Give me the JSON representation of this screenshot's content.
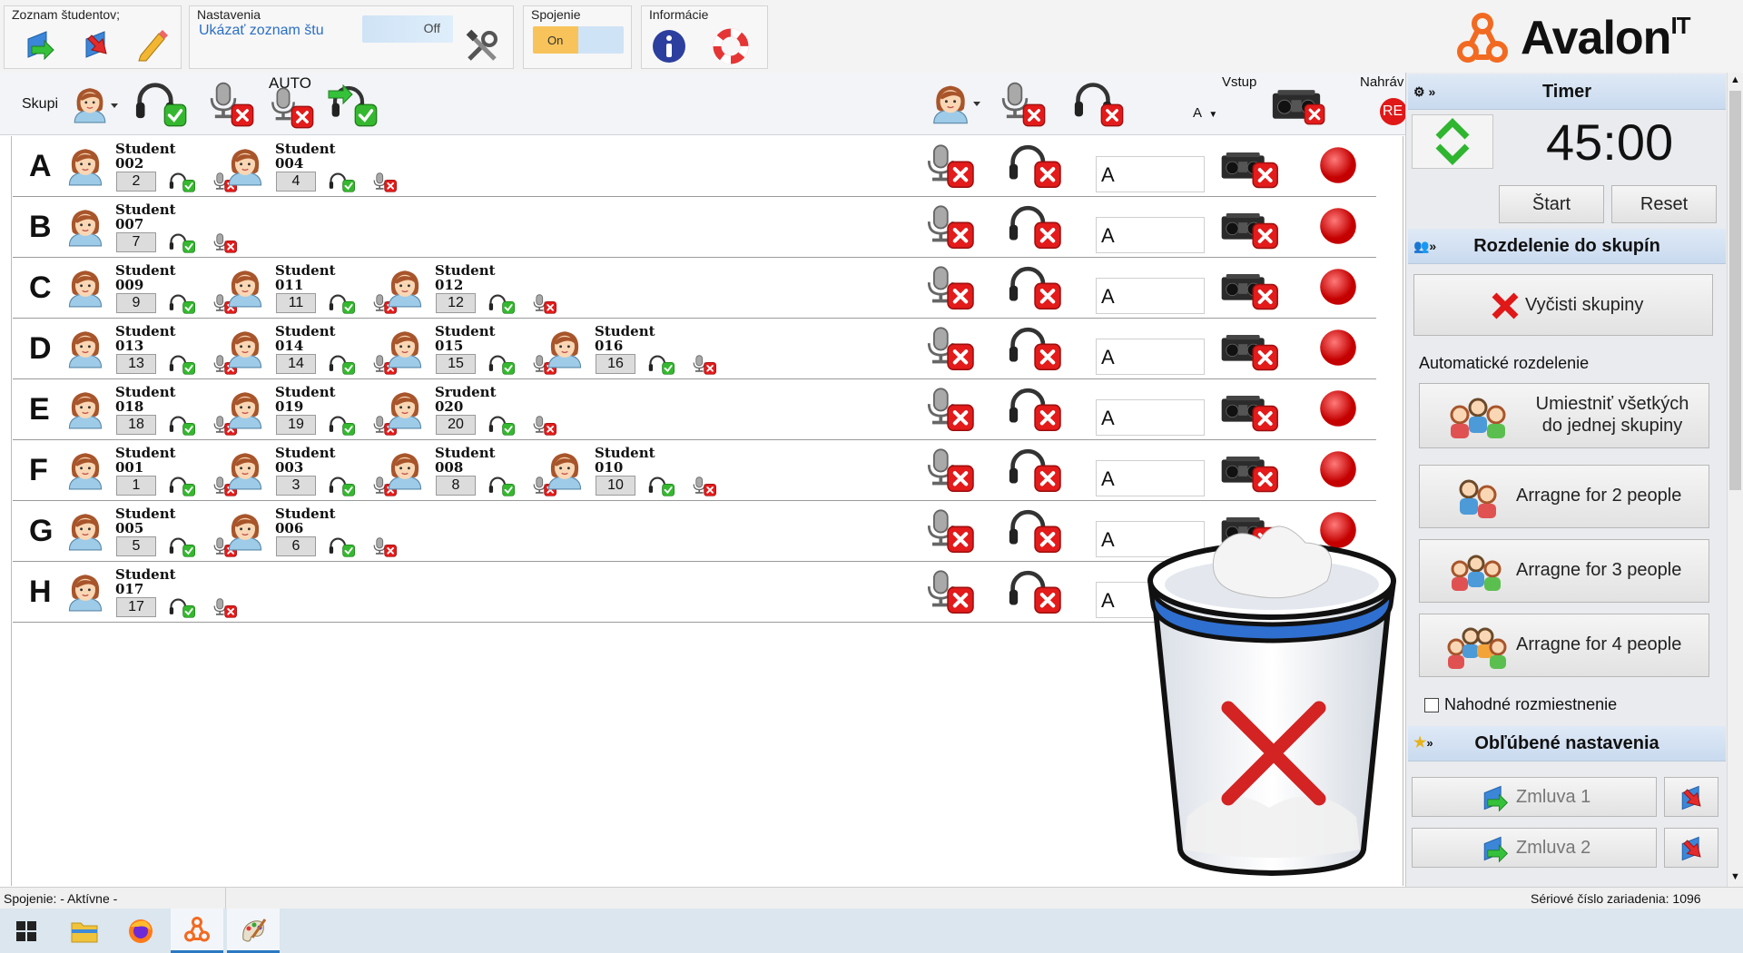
{
  "ribbon": {
    "groups": {
      "students": "Zoznam študentov;",
      "settings": "Nastavenia",
      "connection": "Spojenie",
      "info": "Informácie"
    },
    "show_list_label": "Ukázať zoznam štu",
    "show_list_toggle": "Off",
    "connection_toggle": "On",
    "brand": "Avalon",
    "brand_sup": "IT"
  },
  "toolbar": {
    "groups_label": "Skupi",
    "auto_label": "AUTO",
    "vstup_label": "Vstup",
    "vstup_value": "A",
    "nahrav_label": "Nahráv",
    "rec_label": "RE"
  },
  "groups": [
    {
      "letter": "A",
      "input": "A",
      "students": [
        {
          "name": "Student",
          "id": "002",
          "num": "2"
        },
        {
          "name": "Student",
          "id": "004",
          "num": "4"
        }
      ]
    },
    {
      "letter": "B",
      "input": "A",
      "students": [
        {
          "name": "Student",
          "id": "007",
          "num": "7"
        }
      ]
    },
    {
      "letter": "C",
      "input": "A",
      "students": [
        {
          "name": "Student",
          "id": "009",
          "num": "9"
        },
        {
          "name": "Student",
          "id": "011",
          "num": "11"
        },
        {
          "name": "Student",
          "id": "012",
          "num": "12"
        }
      ]
    },
    {
      "letter": "D",
      "input": "A",
      "students": [
        {
          "name": "Student",
          "id": "013",
          "num": "13"
        },
        {
          "name": "Student",
          "id": "014",
          "num": "14"
        },
        {
          "name": "Student",
          "id": "015",
          "num": "15"
        },
        {
          "name": "Student",
          "id": "016",
          "num": "16"
        }
      ]
    },
    {
      "letter": "E",
      "input": "A",
      "students": [
        {
          "name": "Student",
          "id": "018",
          "num": "18"
        },
        {
          "name": "Student",
          "id": "019",
          "num": "19"
        },
        {
          "name": "Srudent",
          "id": "020",
          "num": "20"
        }
      ]
    },
    {
      "letter": "F",
      "input": "A",
      "students": [
        {
          "name": "Student",
          "id": "001",
          "num": "1"
        },
        {
          "name": "Student",
          "id": "003",
          "num": "3"
        },
        {
          "name": "Student",
          "id": "008",
          "num": "8"
        },
        {
          "name": "Student",
          "id": "010",
          "num": "10"
        }
      ]
    },
    {
      "letter": "G",
      "input": "A",
      "students": [
        {
          "name": "Student",
          "id": "005",
          "num": "5"
        },
        {
          "name": "Student",
          "id": "006",
          "num": "6"
        }
      ]
    },
    {
      "letter": "H",
      "input": "A",
      "students": [
        {
          "name": "Student",
          "id": "017",
          "num": "17"
        }
      ]
    }
  ],
  "panel": {
    "timer_title": "Timer",
    "timer_value": "45:00",
    "start_label": "Štart",
    "reset_label": "Reset",
    "groups_title": "Rozdelenie do skupín",
    "clear_groups": "Vyčisti skupiny",
    "auto_title": "Automatické rozdelenie",
    "all_one_line1": "Umiestniť všetkých",
    "all_one_line2": "do jednej skupiny",
    "arr2": "Arragne for 2 people",
    "arr3": "Arragne for 3 people",
    "arr4": "Arragne for 4 people",
    "random": "Nahodné rozmiestnenie",
    "fav_title": "Obľúbené nastavenia",
    "fav1": "Zmluva 1",
    "fav2": "Zmluva 2"
  },
  "status": {
    "connection": "Spojenie: - Aktívne -",
    "serial": "Sériové číslo zariadenia: 1096"
  },
  "colors": {
    "accent_blue": "#2f6fcf",
    "red": "#e01818",
    "green": "#2fb52f",
    "toggle_on": "#f7c35a"
  },
  "icons": [
    "import-icon",
    "export-icon",
    "edit-icon",
    "tools-icon",
    "info-icon",
    "help-ring-icon",
    "headset-check-icon",
    "mic-muted-icon",
    "recorder-muted-icon",
    "record-dot-icon",
    "trash-bin-icon",
    "windows-start-icon",
    "folder-icon",
    "firefox-icon",
    "avalon-icon",
    "paint-icon"
  ]
}
